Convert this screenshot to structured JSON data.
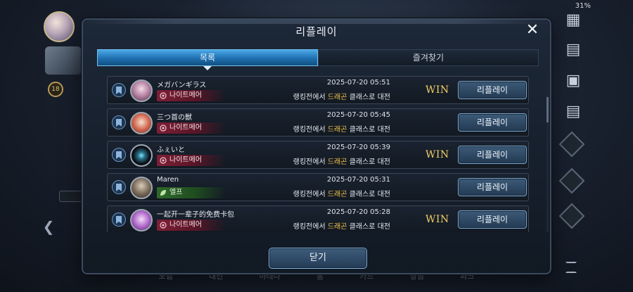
{
  "status_bar": {
    "battery": "31%"
  },
  "background": {
    "level_badge": "18",
    "bottom_nav": [
      "모험",
      "대전",
      "아레나",
      "홈",
      "카드",
      "상점",
      "파크"
    ]
  },
  "modal": {
    "title": "리플레이",
    "tabs": [
      {
        "label": "목록",
        "active": true
      },
      {
        "label": "즐겨찾기",
        "active": false
      }
    ],
    "rows": [
      {
        "player": "メガバンギラス",
        "class": "나이트메어",
        "class_color": "red",
        "date": "2025-07-20 05:51",
        "desc_prefix": "랭킹전에서 ",
        "desc_class": "드래곤",
        "desc_suffix": " 클래스로 대전",
        "result": "WIN",
        "button": "리플레이"
      },
      {
        "player": "三つ首の獣",
        "class": "나이트메어",
        "class_color": "red",
        "date": "2025-07-20 05:45",
        "desc_prefix": "랭킹전에서 ",
        "desc_class": "드래곤",
        "desc_suffix": " 클래스로 대전",
        "result": "",
        "button": "리플레이"
      },
      {
        "player": "ふぇいと",
        "class": "나이트메어",
        "class_color": "red",
        "date": "2025-07-20 05:39",
        "desc_prefix": "랭킹전에서 ",
        "desc_class": "드래곤",
        "desc_suffix": " 클래스로 대전",
        "result": "WIN",
        "button": "리플레이"
      },
      {
        "player": "Maren",
        "class": "엘프",
        "class_color": "green",
        "date": "2025-07-20 05:31",
        "desc_prefix": "랭킹전에서 ",
        "desc_class": "드래곤",
        "desc_suffix": " 클래스로 대전",
        "result": "",
        "button": "리플레이"
      },
      {
        "player": "一起开一辈子的免费卡包",
        "class": "나이트메어",
        "class_color": "red",
        "date": "2025-07-20 05:28",
        "desc_prefix": "랭킹전에서 ",
        "desc_class": "드래곤",
        "desc_suffix": " 클래스로 대전",
        "result": "WIN",
        "button": "리플레이"
      }
    ],
    "close_button": "닫기"
  },
  "colors": {
    "accent_blue": "#1f6fb0",
    "win_gold": "#f0cf66",
    "class_highlight": "#f2c14a",
    "nightmare_red": "#7e1f36",
    "elf_green": "#2e6a2a"
  },
  "icons": {
    "close": "close-icon",
    "favorite": "bookmark-icon",
    "nightmare": "nightmare-class-icon",
    "elf": "elf-class-icon"
  }
}
